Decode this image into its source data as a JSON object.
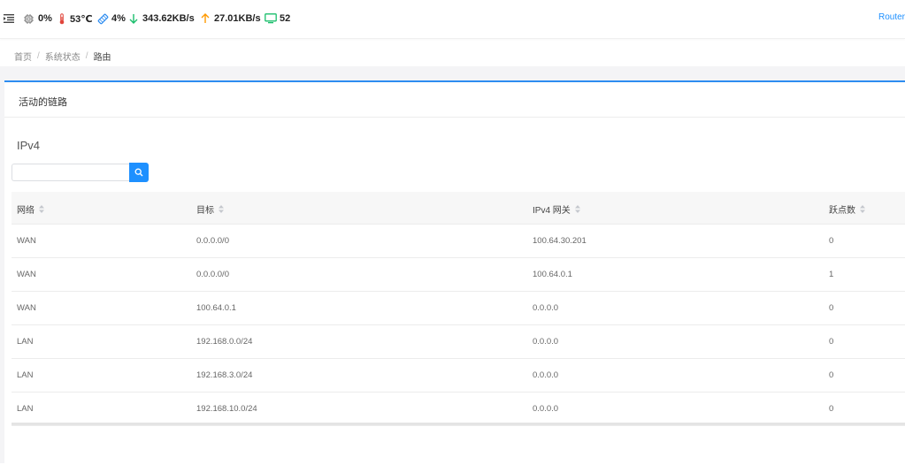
{
  "topbar": {
    "cpu": "0%",
    "temp": "53℃",
    "mem": "4%",
    "download": "343.62KB/s",
    "upload": "27.01KB/s",
    "devices": "52",
    "link": "Router"
  },
  "breadcrumb": [
    "首页",
    "系统状态",
    "路由"
  ],
  "card": {
    "title": "活动的链路",
    "section": "IPv4"
  },
  "search": {
    "value": "",
    "placeholder": ""
  },
  "table": {
    "columns": [
      "网络",
      "目标",
      "IPv4 网关",
      "跃点数"
    ],
    "rows": [
      [
        "WAN",
        "0.0.0.0/0",
        "100.64.30.201",
        "0"
      ],
      [
        "WAN",
        "0.0.0.0/0",
        "100.64.0.1",
        "1"
      ],
      [
        "WAN",
        "100.64.0.1",
        "0.0.0.0",
        "0"
      ],
      [
        "LAN",
        "192.168.0.0/24",
        "0.0.0.0",
        "0"
      ],
      [
        "LAN",
        "192.168.3.0/24",
        "0.0.0.0",
        "0"
      ],
      [
        "LAN",
        "192.168.10.0/24",
        "0.0.0.0",
        "0"
      ]
    ]
  },
  "colors": {
    "accent": "#1e90ff",
    "temp": "#e0443a",
    "mem": "#2d8cf0",
    "down": "#19be6b",
    "up": "#ff9900",
    "devices": "#19be6b"
  },
  "icons": [
    "menu-icon",
    "cpu-icon",
    "thermometer-icon",
    "memory-icon",
    "arrow-down-icon",
    "arrow-up-icon",
    "monitor-icon",
    "search-icon",
    "sort-icon"
  ]
}
